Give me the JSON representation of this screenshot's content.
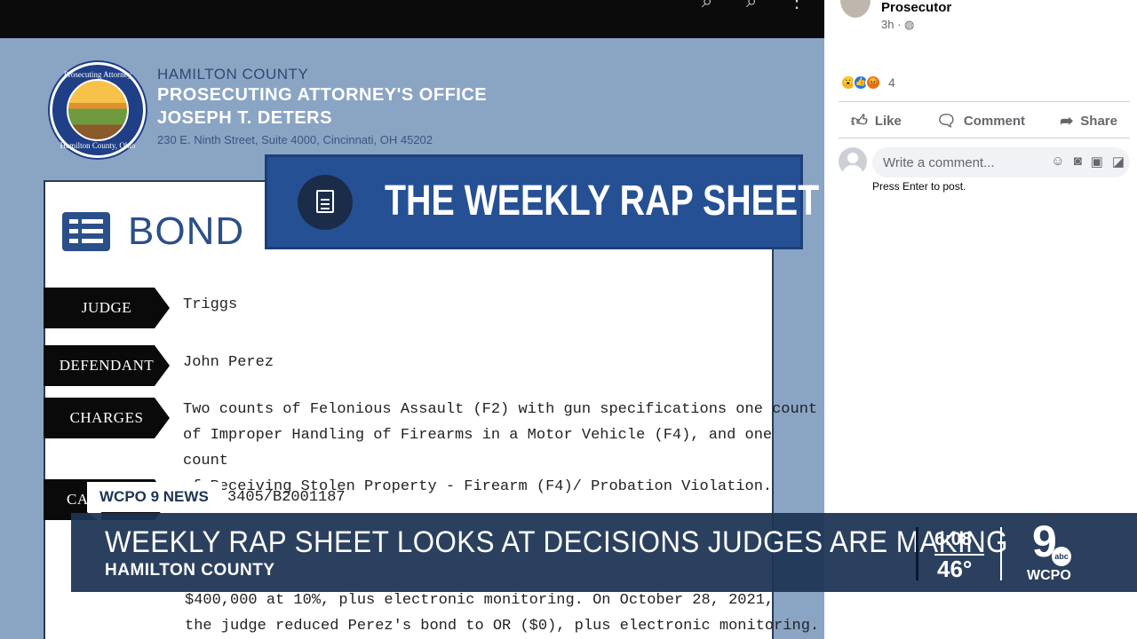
{
  "post_image": {
    "office": {
      "county": "HAMILTON COUNTY",
      "name": "PROSECUTING ATTORNEY'S OFFICE",
      "person": "JOSEPH T. DETERS",
      "address": "230 E. Ninth Street, Suite 4000, Cincinnati, OH 45202"
    },
    "seal": {
      "top_text": "Prosecuting Attorney",
      "bottom_text": "Hamilton County, Ohio"
    },
    "section_title": "BOND",
    "banner_title": "THE WEEKLY RAP SHEET",
    "rows": [
      {
        "tag": "JUDGE",
        "value": "Triggs"
      },
      {
        "tag": "DEFENDANT",
        "value": "John Perez"
      },
      {
        "tag": "CHARGES",
        "lines": [
          "Two counts of Felonious Assault (F2) with gun specifications one count",
          "of Improper Handling of Firearms in a Motor Vehicle (F4), and one count",
          "of Receiving Stolen Property - Firearm (F4)/ Probation Violation."
        ]
      },
      {
        "tag": "CA",
        "value": "3405/B2001187"
      }
    ],
    "bond_lines": [
      "$400,000 at 10%, plus electronic monitoring. On October 28, 2021,",
      "the judge reduced Perez's bond to OR ($0), plus electronic monitoring."
    ]
  },
  "fb": {
    "author": "Prosecutor",
    "meta": "3h · ",
    "reaction_count": "4",
    "actions": {
      "like": "Like",
      "comment": "Comment",
      "share": "Share"
    },
    "comment_placeholder": "Write a comment...",
    "hint": "Press Enter to post."
  },
  "broadcast": {
    "tab": "WCPO 9 NEWS",
    "headline": "WEEKLY RAP SHEET LOOKS AT DECISIONS JUDGES ARE MAKING",
    "subline": "HAMILTON COUNTY",
    "time": "6:08",
    "temperature": "46°",
    "logo_number": "9",
    "logo_network": "abc",
    "logo_brand": "WCPO"
  },
  "colors": {
    "navy": "#1e3454",
    "banner": "#255094",
    "fb_gray": "#65676b"
  }
}
